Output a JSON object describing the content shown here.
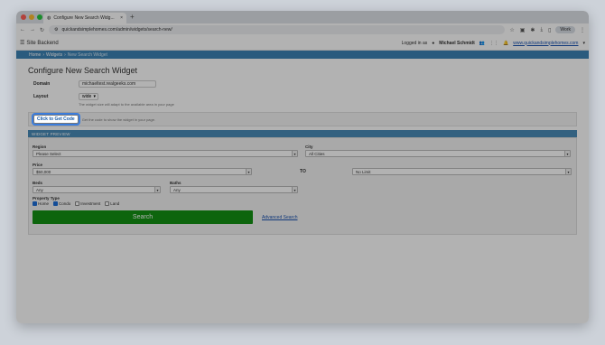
{
  "browser": {
    "tab_title": "Configure New Search Widg...",
    "new_tab": "+",
    "url": "quickandsimplehomes.com/admin/widgets/search-new/",
    "profile_label": "Work"
  },
  "app": {
    "brand": "Site Backend",
    "logged_in_label": "Logged in as",
    "user_name": "Michael Schmidt",
    "site_link": "www.quickandsimplehomes.com"
  },
  "breadcrumb": {
    "home": "Home",
    "widgets": "Widgets",
    "current": "New Search Widget",
    "sep": "›"
  },
  "page": {
    "title": "Configure New Search Widget",
    "domain_label": "Domain",
    "domain_value": "michaeltest.realgeeks.com",
    "layout_label": "Layout",
    "layout_value": "wide",
    "layout_hint": "The widget size will adapt to the available area in your page",
    "get_code_button": "Click to Get Code",
    "get_code_hint": "Get the code to show the widget in your page."
  },
  "preview": {
    "header": "WIDGET PREVIEW",
    "region_label": "Region",
    "region_value": "Please Select",
    "city_label": "City",
    "city_value": "All Cities",
    "price_label": "Price",
    "price_min": "$50,000",
    "to_label": "TO",
    "price_max": "No Limit",
    "beds_label": "Beds",
    "beds_value": "Any",
    "baths_label": "Baths",
    "baths_value": "Any",
    "property_type_label": "Property Type",
    "types": [
      {
        "label": "Home",
        "checked": true
      },
      {
        "label": "Condo",
        "checked": true
      },
      {
        "label": "Investment",
        "checked": false
      },
      {
        "label": "Land",
        "checked": false
      }
    ],
    "search_button": "Search",
    "advanced_link": "Advanced Search"
  },
  "colors": {
    "breadcrumb_bg": "#3d83b5",
    "search_green": "#139113",
    "link_blue": "#1a52b0"
  }
}
